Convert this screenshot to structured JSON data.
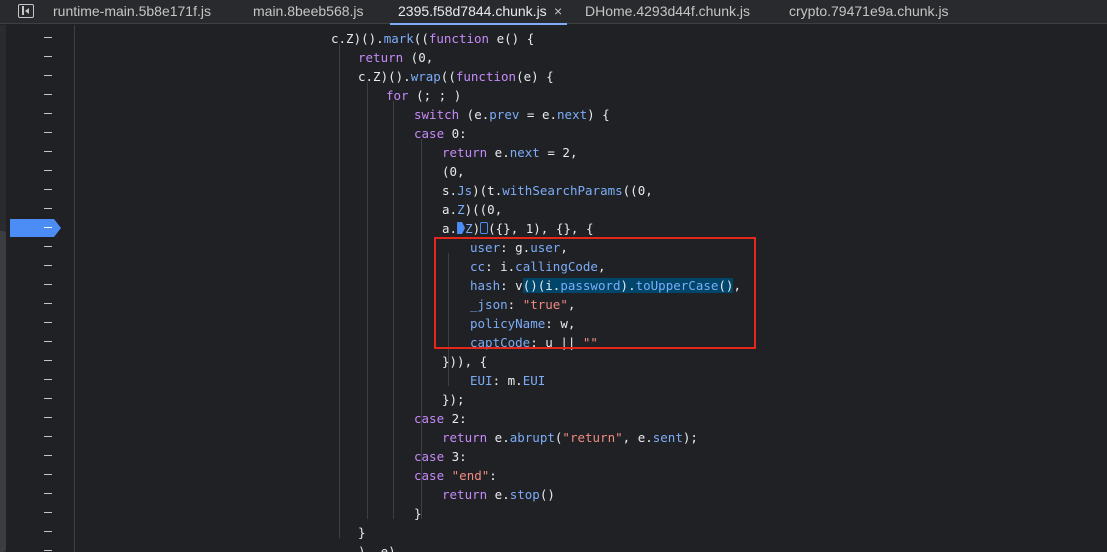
{
  "tabs": [
    {
      "label": "runtime-main.5b8e171f.js",
      "active": false
    },
    {
      "label": "main.8beeb568.js",
      "active": false
    },
    {
      "label": "2395.f58d7844.chunk.js",
      "active": true
    },
    {
      "label": "DHome.4293d44f.chunk.js",
      "active": false
    },
    {
      "label": "crypto.79471e9a.chunk.js",
      "active": false
    }
  ],
  "close_glyph": "×",
  "code": {
    "l1": [
      "c.Z)().",
      "mark",
      "((",
      "function",
      " e() {"
    ],
    "l2": [
      "return",
      " (0,"
    ],
    "l3": [
      "c.Z)().",
      "wrap",
      "((",
      "function",
      "(e) {"
    ],
    "l4": [
      "for",
      " (; ; )"
    ],
    "l5": [
      "switch",
      " (e.",
      "prev",
      " = e.",
      "next",
      ") {"
    ],
    "l6": [
      "case",
      " 0:"
    ],
    "l7": [
      "return",
      " e.",
      "next",
      " = 2,"
    ],
    "l8": [
      "(0,"
    ],
    "l9": [
      "s.",
      "Js",
      ")(t.",
      "withSearchParams",
      "((0,"
    ],
    "l10": [
      "a.",
      "Z",
      ")((0,"
    ],
    "l11": [
      "a.",
      "Z",
      ")",
      "({}, 1), {}, {"
    ],
    "l12": [
      "user",
      ": g.",
      "user",
      ","
    ],
    "l13": [
      "cc",
      ": i.",
      "callingCode",
      ","
    ],
    "l14": [
      "hash",
      ": v",
      "()(i.",
      "password",
      ").",
      "toUpperCase",
      "()",
      ","
    ],
    "l15": [
      "_json",
      ": ",
      "\"true\"",
      ","
    ],
    "l16": [
      "policyName",
      ": w,"
    ],
    "l17": [
      "captCode",
      ": u || ",
      "\"\""
    ],
    "l18": [
      "})), {"
    ],
    "l19": [
      "EUI",
      ": m.",
      "EUI"
    ],
    "l20": [
      "});"
    ],
    "l21": [
      "case",
      " 2:"
    ],
    "l22": [
      "return",
      " e.",
      "abrupt",
      "(",
      "\"return\"",
      ", e.",
      "sent",
      ");"
    ],
    "l23": [
      "case",
      " 3:"
    ],
    "l24": [
      "case",
      " ",
      "\"end\"",
      ":"
    ],
    "l25": [
      "return",
      " e.",
      "stop",
      "()"
    ],
    "l26": [
      "}"
    ],
    "l27": [
      "}"
    ],
    "l28": [
      "), e)"
    ]
  },
  "colors": {
    "background": "#202124",
    "keyword": "#c58af9",
    "property": "#7cacf8",
    "string": "#f28b82",
    "breakpoint": "#4b8cf5",
    "highlight_box": "#e3271b"
  }
}
